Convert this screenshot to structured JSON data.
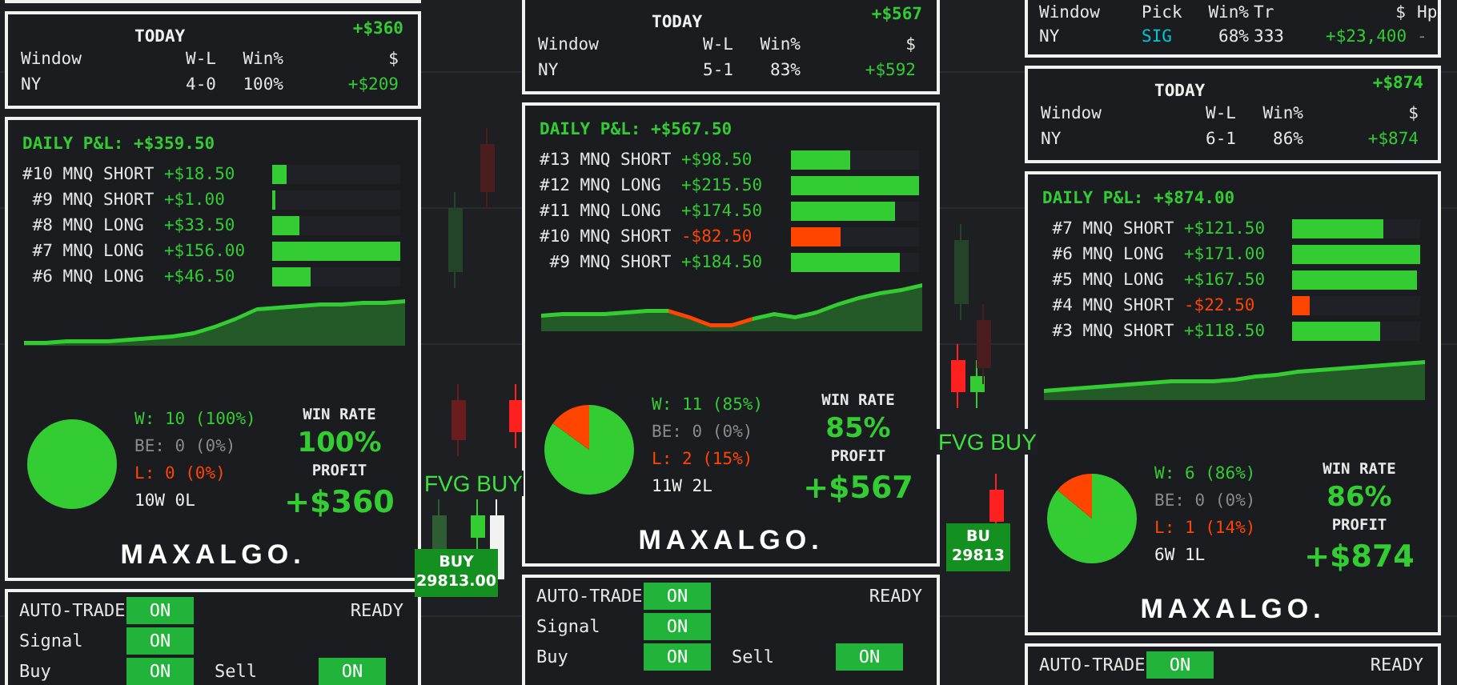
{
  "columns": [
    {
      "cut_panel_above": true,
      "today": {
        "title": "TODAY",
        "total": "+$360",
        "header": [
          "Window",
          "W-L",
          "Win%",
          "$"
        ],
        "row": [
          {
            "text": "NY"
          },
          {
            "text": "4-0"
          },
          {
            "text": "100%"
          },
          {
            "text": "+$209",
            "color": "#33cc33"
          }
        ]
      },
      "pnl": {
        "title": "DAILY P&L: +$359.50",
        "trades": [
          {
            "id": "#10",
            "side": "MNQ SHORT",
            "amount": "+$18.50",
            "color": "#33cc33",
            "level": 0.11
          },
          {
            "id": "#9",
            "side": "MNQ SHORT",
            "amount": "+$1.00",
            "color": "#33cc33",
            "level": 0.02
          },
          {
            "id": "#8",
            "side": "MNQ LONG",
            "amount": "+$33.50",
            "color": "#33cc33",
            "level": 0.21
          },
          {
            "id": "#7",
            "side": "MNQ LONG",
            "amount": "+$156.00",
            "color": "#33cc33",
            "level": 1
          },
          {
            "id": "#6",
            "side": "MNQ LONG",
            "amount": "+$46.50",
            "color": "#33cc33",
            "level": 0.3
          }
        ],
        "chart_data": {
          "type": "pie",
          "values": [
            100,
            0,
            0
          ]
        },
        "legend": [
          {
            "kind": "win",
            "text": "W: 10 (100%)"
          },
          {
            "kind": "breakeven",
            "text": "BE: 0 (0%)"
          },
          {
            "kind": "loss",
            "text": "L: 0 (0%)"
          },
          {
            "kind": "record",
            "text": "10W 0L"
          }
        ],
        "win_rate_label": "WIN RATE",
        "win_rate": "100%",
        "profit_label": "PROFIT",
        "profit": "+$360",
        "logo": "MAXALGO."
      },
      "controls": [
        {
          "cells": [
            {
              "kind": "label",
              "text": "AUTO-TRADE"
            },
            {
              "kind": "toggle",
              "text": "ON",
              "on": true
            },
            {
              "kind": "status",
              "text": "READY"
            }
          ]
        },
        {
          "cells": [
            {
              "kind": "label",
              "text": "Signal"
            },
            {
              "kind": "toggle",
              "text": "ON",
              "on": true
            }
          ]
        },
        {
          "cells": [
            {
              "kind": "label",
              "text": "Buy"
            },
            {
              "kind": "toggle",
              "text": "ON",
              "on": true
            },
            {
              "kind": "label",
              "text": "Sell"
            },
            {
              "kind": "toggle",
              "text": "ON",
              "on": true
            }
          ]
        }
      ]
    },
    {
      "today": {
        "title": "TODAY",
        "total": "+$567",
        "header": [
          "Window",
          "W-L",
          "Win%",
          "$"
        ],
        "row": [
          {
            "text": "NY"
          },
          {
            "text": "5-1"
          },
          {
            "text": "83%"
          },
          {
            "text": "+$592",
            "color": "#33cc33"
          }
        ]
      },
      "pnl": {
        "title": "DAILY P&L: +$567.50",
        "trades": [
          {
            "id": "#13",
            "side": "MNQ SHORT",
            "amount": "+$98.50",
            "color": "#33cc33",
            "level": 0.46
          },
          {
            "id": "#12",
            "side": "MNQ LONG",
            "amount": "+$215.50",
            "color": "#33cc33",
            "level": 1
          },
          {
            "id": "#11",
            "side": "MNQ LONG",
            "amount": "+$174.50",
            "color": "#33cc33",
            "level": 0.81
          },
          {
            "id": "#10",
            "side": "MNQ SHORT",
            "amount": "-$82.50",
            "color": "#ff4500",
            "level": 0.39
          },
          {
            "id": "#9",
            "side": "MNQ SHORT",
            "amount": "+$184.50",
            "color": "#33cc33",
            "level": 0.85
          }
        ],
        "chart_data": {
          "type": "pie",
          "values": [
            85,
            0,
            15
          ]
        },
        "legend": [
          {
            "kind": "win",
            "text": "W: 11 (85%)"
          },
          {
            "kind": "breakeven",
            "text": "BE: 0 (0%)"
          },
          {
            "kind": "loss",
            "text": "L: 2 (15%)"
          },
          {
            "kind": "record",
            "text": "11W 2L"
          }
        ],
        "win_rate_label": "WIN RATE",
        "win_rate": "85%",
        "profit_label": "PROFIT",
        "profit": "+$567",
        "logo": "MAXALGO."
      },
      "controls": [
        {
          "cells": [
            {
              "kind": "label",
              "text": "AUTO-TRADE"
            },
            {
              "kind": "toggle",
              "text": "ON",
              "on": true
            },
            {
              "kind": "status",
              "text": "READY"
            }
          ]
        },
        {
          "cells": [
            {
              "kind": "label",
              "text": "Signal"
            },
            {
              "kind": "toggle",
              "text": "ON",
              "on": true
            }
          ]
        },
        {
          "cells": [
            {
              "kind": "label",
              "text": "Buy"
            },
            {
              "kind": "toggle",
              "text": "ON",
              "on": true
            },
            {
              "kind": "label",
              "text": "Sell"
            },
            {
              "kind": "toggle",
              "text": "ON",
              "on": true
            }
          ]
        }
      ]
    },
    {
      "stats": {
        "header": [
          "Window",
          "Pick",
          "Win%",
          "Tr",
          "$",
          "Hp"
        ],
        "row": [
          {
            "text": "NY"
          },
          {
            "text": "SIG",
            "color": "#00c8d8"
          },
          {
            "text": "68%"
          },
          {
            "text": "333"
          },
          {
            "text": "+$23,400",
            "color": "#33cc33"
          },
          {
            "text": "-",
            "color": "#888888"
          }
        ]
      },
      "today": {
        "title": "TODAY",
        "total": "+$874",
        "header": [
          "Window",
          "W-L",
          "Win%",
          "$"
        ],
        "row": [
          {
            "text": "NY"
          },
          {
            "text": "6-1"
          },
          {
            "text": "86%"
          },
          {
            "text": "+$874",
            "color": "#33cc33"
          }
        ]
      },
      "pnl": {
        "title": "DAILY P&L: +$874.00",
        "trades": [
          {
            "id": "#7",
            "side": "MNQ SHORT",
            "amount": "+$121.50",
            "color": "#33cc33",
            "level": 0.71
          },
          {
            "id": "#6",
            "side": "MNQ LONG",
            "amount": "+$171.00",
            "color": "#33cc33",
            "level": 1
          },
          {
            "id": "#5",
            "side": "MNQ LONG",
            "amount": "+$167.50",
            "color": "#33cc33",
            "level": 0.98
          },
          {
            "id": "#4",
            "side": "MNQ SHORT",
            "amount": "-$22.50",
            "color": "#ff4500",
            "level": 0.14
          },
          {
            "id": "#3",
            "side": "MNQ SHORT",
            "amount": "+$118.50",
            "color": "#33cc33",
            "level": 0.69
          }
        ],
        "chart_data": {
          "type": "pie",
          "values": [
            86,
            0,
            14
          ]
        },
        "legend": [
          {
            "kind": "win",
            "text": "W: 6 (86%)"
          },
          {
            "kind": "breakeven",
            "text": "BE: 0 (0%)"
          },
          {
            "kind": "loss",
            "text": "L: 1 (14%)"
          },
          {
            "kind": "record",
            "text": "6W 1L"
          }
        ],
        "win_rate_label": "WIN RATE",
        "win_rate": "86%",
        "profit_label": "PROFIT",
        "profit": "+$874",
        "logo": "MAXALGO."
      },
      "controls": [
        {
          "cells": [
            {
              "kind": "label",
              "text": "AUTO-TRADE"
            },
            {
              "kind": "toggle",
              "text": "ON",
              "on": true
            },
            {
              "kind": "status",
              "text": "READY"
            }
          ]
        }
      ]
    }
  ],
  "chart_labels": [
    {
      "kind": "signal",
      "lines": [
        "FVG BUY"
      ]
    },
    {
      "kind": "signal",
      "lines": [
        "FVG BUY"
      ]
    },
    {
      "kind": "order",
      "lines": [
        "BUY",
        "29813.00"
      ]
    },
    {
      "kind": "order",
      "lines": [
        "BU",
        "29813"
      ]
    }
  ]
}
